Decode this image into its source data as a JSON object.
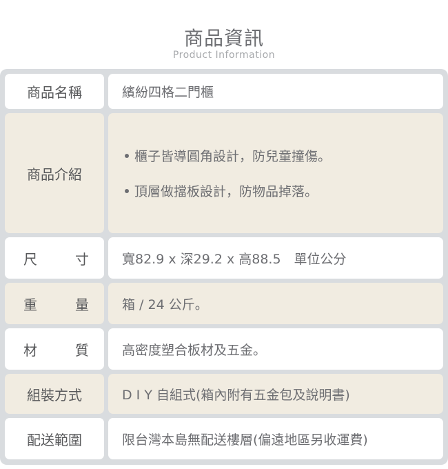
{
  "header": {
    "title": "商品資訊",
    "subtitle": "Product Information"
  },
  "rows": [
    {
      "label": "商品名稱",
      "value": "繽紛四格二門櫃"
    },
    {
      "label": "商品介紹",
      "bullets": [
        "櫃子皆導圓角設計，防兒童撞傷。",
        "頂層做擋板設計，防物品掉落。"
      ]
    },
    {
      "label_chars": [
        "尺",
        "寸"
      ],
      "value": "寬82.9 x 深29.2 x 高88.5　單位公分"
    },
    {
      "label_chars": [
        "重",
        "量"
      ],
      "value": "箱 / 24 公斤。"
    },
    {
      "label_chars": [
        "材",
        "質"
      ],
      "value": "高密度塑合板材及五金。"
    },
    {
      "label": "組裝方式",
      "value": "D I Y 自組式(箱內附有五金包及說明書)"
    },
    {
      "label": "配送範圍",
      "value": "限台灣本島無配送樓層(偏遠地區另收運費)"
    }
  ],
  "colors": {
    "frame": "#d9dcdf",
    "cell_white": "#ffffff",
    "cell_beige": "#f1ece1",
    "text": "#6d6e72"
  }
}
